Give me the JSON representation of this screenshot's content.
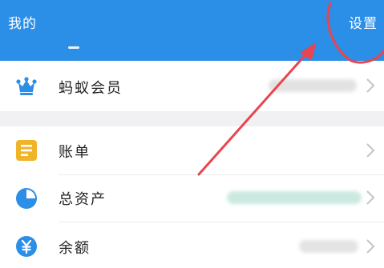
{
  "header": {
    "title": "我的",
    "settings_label": "设置",
    "background": "#2b8ee7"
  },
  "rows": [
    {
      "id": "member",
      "label": "蚂蚁会员",
      "icon": "crown-icon",
      "icon_color": "#2b8ee7"
    },
    {
      "id": "bill",
      "label": "账单",
      "icon": "bill-icon",
      "icon_color": "#f0b429"
    },
    {
      "id": "assets",
      "label": "总资产",
      "icon": "pie-chart-icon",
      "icon_color": "#2b8ee7"
    },
    {
      "id": "balance",
      "label": "余额",
      "icon": "yuan-icon",
      "icon_color": "#2b8ee7"
    }
  ],
  "annotation": {
    "color": "#e8454f",
    "shape": "arrow pointing to settings, circled"
  }
}
